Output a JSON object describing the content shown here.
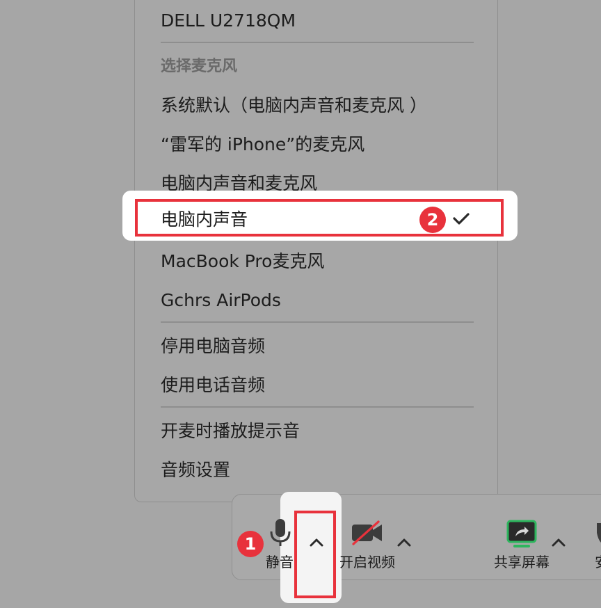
{
  "menu": {
    "speaker_item": "DELL U2718QM",
    "mic_header": "选择麦克风",
    "mic_items": [
      "系统默认（电脑内声音和麦克风 ）",
      "“雷军的 iPhone”的麦克风",
      "电脑内声音和麦克风",
      "电脑内声音",
      "MacBook Pro麦克风",
      "Gchrs AirPods"
    ],
    "selected_index": 3,
    "audio_items": [
      "停用电脑音频",
      "使用电话音频"
    ],
    "extra_items": [
      "开麦时播放提示音",
      "音频设置"
    ]
  },
  "toolbar": {
    "mute_label": "静音",
    "video_label": "开启视频",
    "share_label": "共享屏幕",
    "partial_label": "安"
  },
  "annotations": {
    "step1": "1",
    "step2": "2"
  },
  "colors": {
    "highlight": "#e8323c",
    "share_green": "#2db55d"
  },
  "icons": [
    "microphone-icon",
    "chevron-up-icon",
    "video-off-icon",
    "share-screen-icon",
    "checkmark-icon"
  ]
}
